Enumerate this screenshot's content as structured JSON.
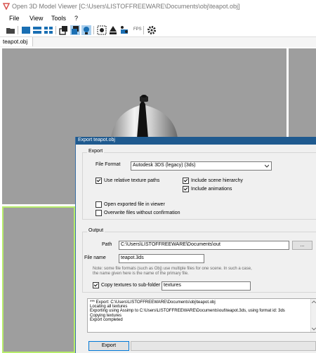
{
  "window": {
    "title": "Open 3D Model Viewer  [C:\\Users\\LISTOFFREEWARE\\Documents\\obj\\teapot.obj]"
  },
  "menu": {
    "items": [
      "File",
      "View",
      "Tools",
      "?"
    ]
  },
  "toolbar": {
    "fps_label": "FPS"
  },
  "tabs": [
    {
      "label": "teapot.obj"
    }
  ],
  "dialog": {
    "title": "Export teapot.obj",
    "export_group": {
      "title": "Export",
      "file_format_label": "File Format",
      "file_format_value": "Autodesk 3DS (legacy) (3ds)",
      "use_relative_texture_paths": {
        "label": "Use relative texture paths",
        "checked": true
      },
      "include_scene_hierarchy": {
        "label": "Include scene hierarchy",
        "checked": true
      },
      "include_animations": {
        "label": "Include animations",
        "checked": true
      },
      "open_exported_file": {
        "label": "Open exported file in viewer",
        "checked": false
      },
      "overwrite_files": {
        "label": "Overwrite files without confirmation",
        "checked": false
      }
    },
    "output_group": {
      "title": "Output",
      "path_label": "Path",
      "path_value": "C:\\Users\\LISTOFFREEWARE\\Documents\\out",
      "browse_label": "...",
      "file_name_label": "File name",
      "file_name_value": "teapot.3ds",
      "note": "Note: some file formats (such as Obj) use multiple files for one scene. In such a case,\nthe name given here is the name of the primary file.",
      "copy_textures": {
        "label": "Copy textures to sub-folder",
        "checked": true
      },
      "textures_folder_value": "textures"
    },
    "log": "*** Export: C:\\Users\\LISTOFFREEWARE\\Documents\\obj\\teapot.obj\nLocating all textures\nExporting using Assimp to C:\\Users\\LISTOFFREEWARE\\Documents\\out\\teapot.3ds, using format id: 3ds\nCopying textures\nExport completed",
    "export_button": "Export"
  }
}
